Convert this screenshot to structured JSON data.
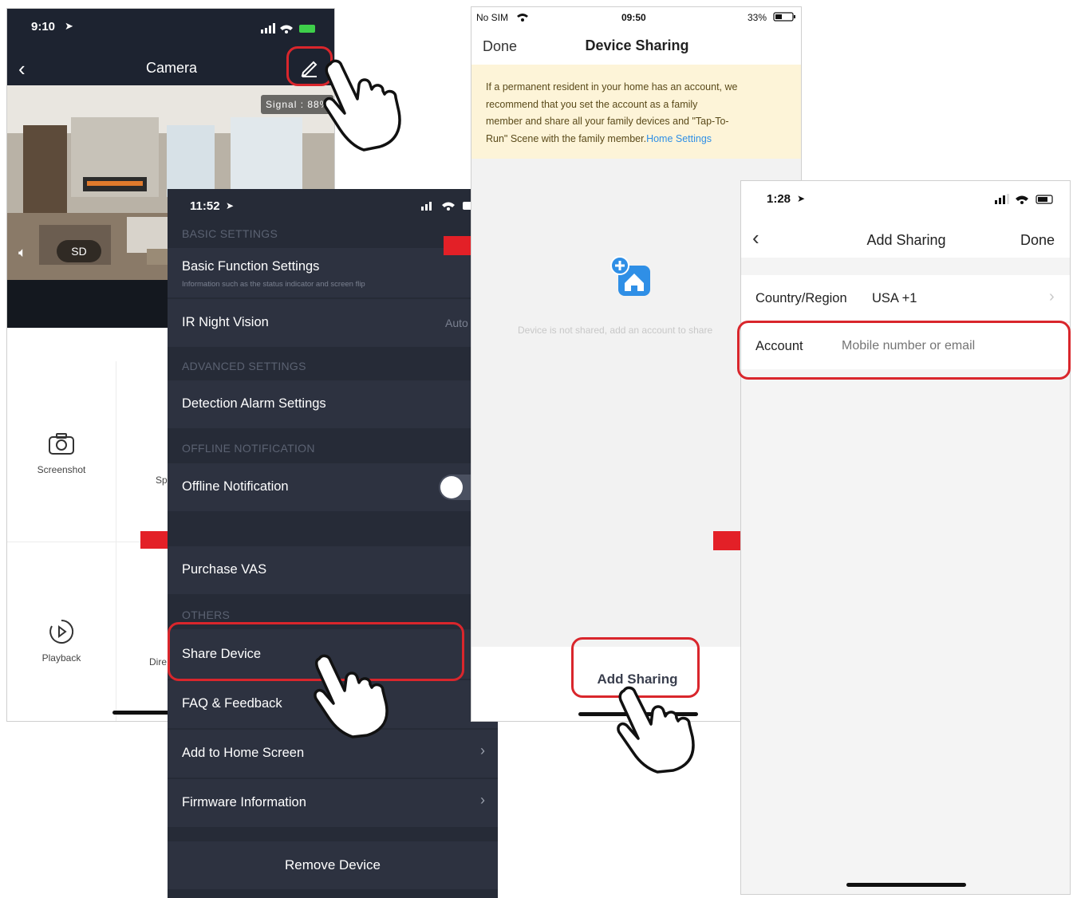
{
  "camera": {
    "time": "9:10",
    "title": "Camera",
    "signal": "Signal : 88%",
    "sd_label": "SD",
    "screenshot_label": "Screenshot",
    "speak_label_partial": "Sp",
    "playback_label": "Playback",
    "direction_label_partial": "Dire"
  },
  "settings": {
    "time": "11:52",
    "section_basic": "BASIC SETTINGS",
    "basic_function": "Basic Function Settings",
    "basic_function_sub": "Information such as the status indicator and screen flip",
    "ir_night": "IR Night Vision",
    "ir_night_value": "Auto",
    "section_advanced": "ADVANCED SETTINGS",
    "detection_alarm": "Detection Alarm Settings",
    "section_offline": "OFFLINE NOTIFICATION",
    "offline_notification": "Offline Notification",
    "offline_toggle_on": false,
    "purchase_vas": "Purchase VAS",
    "section_others": "OTHERS",
    "share_device": "Share Device",
    "faq": "FAQ & Feedback",
    "add_home": "Add to Home Screen",
    "firmware": "Firmware Information",
    "remove": "Remove Device"
  },
  "sharing": {
    "carrier": "No SIM",
    "time": "09:50",
    "battery": "33%",
    "done": "Done",
    "title": "Device Sharing",
    "notice_lines": [
      "If a permanent resident in your home has an account, we",
      "recommend that you set the account as a family",
      "member and share all your family devices and \"Tap-To-",
      "Run\" Scene with the family member."
    ],
    "notice_link": "Home Settings",
    "empty_text": "Device is not shared, add an account to share",
    "add_sharing": "Add Sharing"
  },
  "add_sharing": {
    "time": "1:28",
    "title": "Add Sharing",
    "done": "Done",
    "country_label": "Country/Region",
    "country_value": "USA +1",
    "account_label": "Account",
    "account_placeholder": "Mobile number or email"
  },
  "colors": {
    "highlight_red": "#d9262c",
    "dark_bg": "#262b37",
    "link_blue": "#2f8fe6",
    "notice_bg": "#fdf4d8"
  }
}
